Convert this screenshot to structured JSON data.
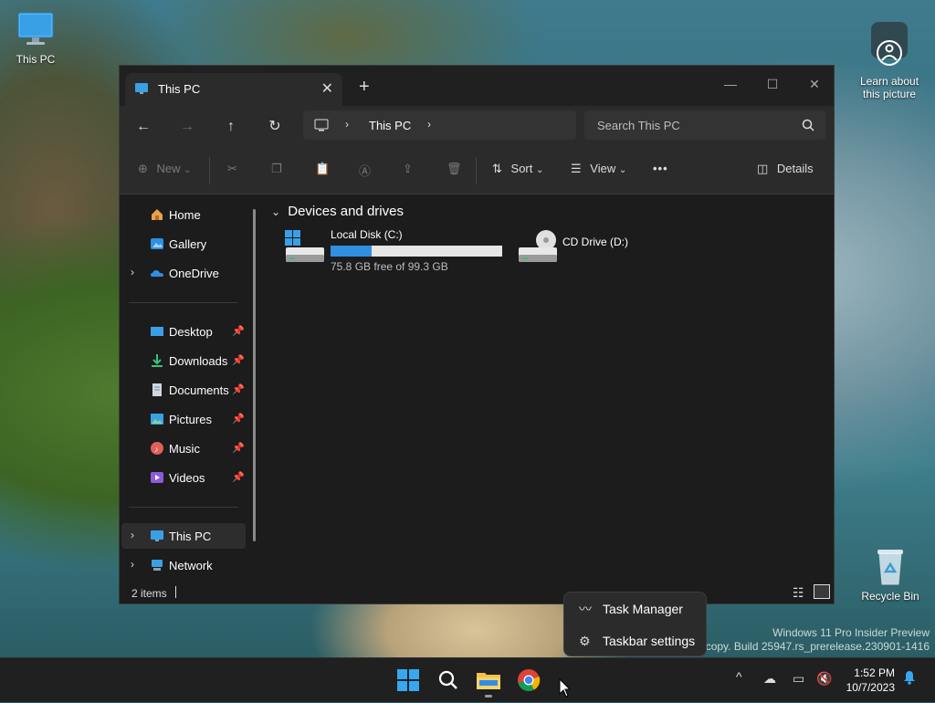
{
  "desktop": {
    "this_pc_label": "This PC",
    "learn_label": "Learn about\nthis picture",
    "recycle_bin_label": "Recycle Bin",
    "watermark_line1": "Windows 11 Pro Insider Preview",
    "watermark_line2": "Evaluation copy. Build 25947.rs_prerelease.230901-1416"
  },
  "window": {
    "tab_title": "This PC",
    "tab_close": "✕",
    "new_tab": "+",
    "controls": {
      "minimize": "—",
      "maximize": "☐",
      "close": "✕"
    }
  },
  "navbar": {
    "back": "←",
    "forward": "→",
    "up": "↑",
    "refresh": "↻",
    "breadcrumb": "This PC",
    "search_placeholder": "Search This PC"
  },
  "commandbar": {
    "new_label": "New",
    "sort_label": "Sort",
    "view_label": "View",
    "more_label": "•••",
    "details_label": "Details"
  },
  "sidebar": {
    "items": [
      {
        "label": "Home"
      },
      {
        "label": "Gallery"
      },
      {
        "label": "OneDrive"
      },
      {
        "label": "Desktop"
      },
      {
        "label": "Downloads"
      },
      {
        "label": "Documents"
      },
      {
        "label": "Pictures"
      },
      {
        "label": "Music"
      },
      {
        "label": "Videos"
      },
      {
        "label": "This PC"
      },
      {
        "label": "Network"
      }
    ],
    "pin_glyph": "📌"
  },
  "content": {
    "group_title": "Devices and drives",
    "drives": [
      {
        "name": "Local Disk (C:)",
        "free_text": "75.8 GB free of 99.3 GB",
        "used_fraction": 0.237
      },
      {
        "name": "CD Drive (D:)"
      }
    ]
  },
  "statusbar": {
    "items_text": "2 items"
  },
  "context_menu": {
    "items": [
      {
        "label": "Task Manager"
      },
      {
        "label": "Taskbar settings"
      }
    ]
  },
  "taskbar": {
    "time": "1:52 PM",
    "date": "10/7/2023",
    "chevron": "^"
  },
  "colors": {
    "accent": "#2f8fe0",
    "window_bg": "#1c1c1c",
    "toolbar_bg": "#2b2b2b"
  }
}
